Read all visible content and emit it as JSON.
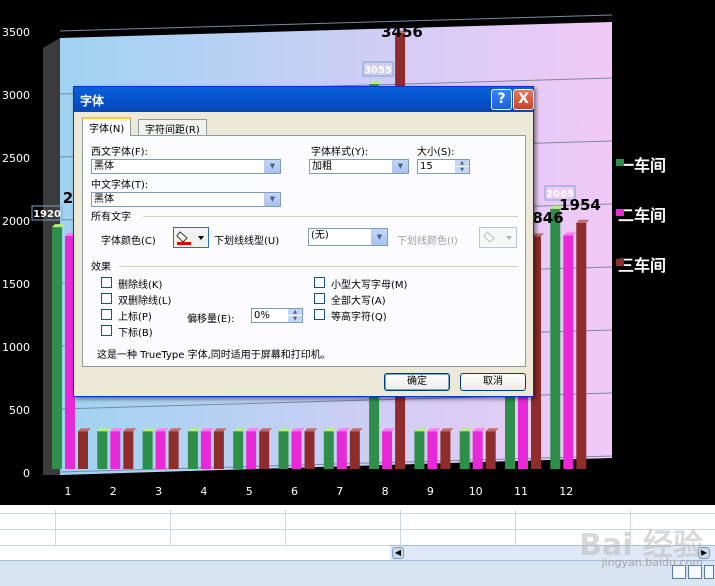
{
  "chart_data": {
    "type": "bar",
    "categories": [
      "1",
      "2",
      "3",
      "4",
      "5",
      "6",
      "7",
      "8",
      "9",
      "10",
      "11",
      "12"
    ],
    "y_ticks": [
      "0",
      "500",
      "1000",
      "1500",
      "2000",
      "2500",
      "3000",
      "3500"
    ],
    "ylim": [
      0,
      3500
    ],
    "series": [
      {
        "name": "一车间",
        "color": "#2e8f4a",
        "values": [
          1920,
          300,
          300,
          300,
          300,
          300,
          300,
          3055,
          300,
          300,
          1900,
          2065
        ]
      },
      {
        "name": "二车间",
        "color": "#e829d8",
        "values": [
          1850,
          300,
          300,
          300,
          300,
          300,
          300,
          300,
          300,
          300,
          1850,
          1854
        ]
      },
      {
        "name": "三车间",
        "color": "#8f2c2c",
        "values": [
          300,
          300,
          300,
          300,
          300,
          300,
          300,
          3456,
          300,
          300,
          1846,
          1954
        ]
      }
    ],
    "data_labels": [
      "1920",
      "3055",
      "3456",
      "2065",
      "1954",
      "846",
      "2"
    ]
  },
  "dialog": {
    "title": "字体",
    "help": "?",
    "close": "X",
    "tabs": [
      "字体(N)",
      "字符间距(R)"
    ],
    "western_font_label": "西文字体(F):",
    "western_font_value": "黑体",
    "cjk_font_label": "中文字体(T):",
    "cjk_font_value": "黑体",
    "style_label": "字体样式(Y):",
    "style_value": "加粗",
    "size_label": "大小(S):",
    "size_value": "15",
    "all_text_heading": "所有文字",
    "font_color_label": "字体颜色(C)",
    "underline_label": "下划线线型(U)",
    "underline_value": "(无)",
    "underline_color_label": "下划线颜色(I)",
    "effects_heading": "效果",
    "effects_left": [
      "删除线(K)",
      "双删除线(L)",
      "上标(P)",
      "下标(B)"
    ],
    "effects_right": [
      "小型大写字母(M)",
      "全部大写(A)",
      "等高字符(Q)"
    ],
    "offset_label": "偏移量(E):",
    "offset_value": "0%",
    "footer_note": "这是一种 TrueType 字体,同时适用于屏幕和打印机。",
    "ok": "确定",
    "cancel": "取消"
  },
  "watermark": {
    "brand": "Bai 经验",
    "url": "jingyan.baidu.com"
  }
}
